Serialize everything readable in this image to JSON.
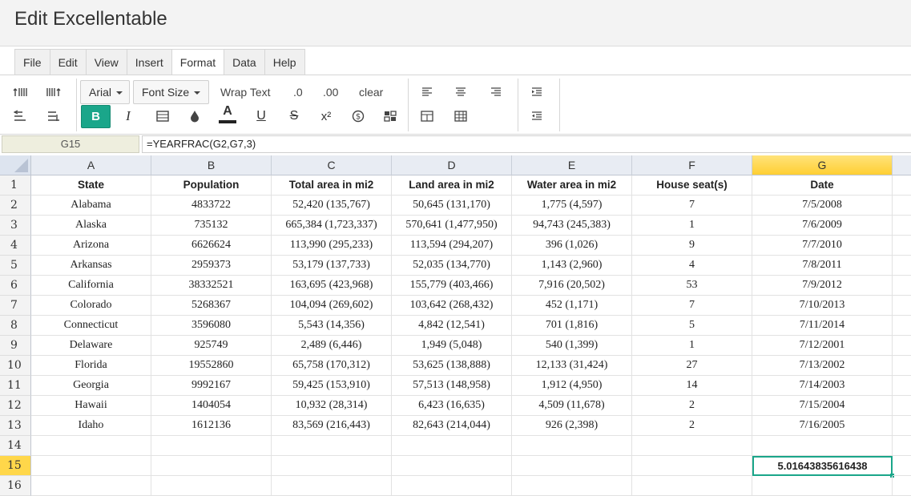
{
  "app": {
    "title": "Edit Excellentable"
  },
  "menu": {
    "items": [
      "File",
      "Edit",
      "View",
      "Insert",
      "Format",
      "Data",
      "Help"
    ],
    "active": "Format"
  },
  "toolbar": {
    "font_name": "Arial",
    "font_size": "Font Size",
    "wrap_text": "Wrap Text",
    "decimal_decrease": ".0",
    "decimal_increase": ".00",
    "clear": "clear",
    "bold": "B",
    "italic": "I",
    "text_color_letter": "A",
    "underline": "U",
    "strikethrough": "S",
    "superscript": "x²",
    "accent_color": "#1aa68a"
  },
  "formula_bar": {
    "cell_ref": "G15",
    "formula": "=YEARFRAC(G2,G7,3)"
  },
  "sheet": {
    "columns": [
      "A",
      "B",
      "C",
      "D",
      "E",
      "F",
      "G"
    ],
    "selected_column": "G",
    "selected_row": "15",
    "row_numbers": [
      "1",
      "2",
      "3",
      "4",
      "5",
      "6",
      "7",
      "8",
      "9",
      "10",
      "11",
      "12",
      "13",
      "14",
      "15",
      "16"
    ],
    "rows": [
      [
        "State",
        "Population",
        "Total area in mi2",
        "Land area in mi2",
        "Water area in mi2",
        "House seat(s)",
        "Date"
      ],
      [
        "Alabama",
        "4833722",
        "52,420 (135,767)",
        "50,645 (131,170)",
        "1,775 (4,597)",
        "7",
        "7/5/2008"
      ],
      [
        "Alaska",
        "735132",
        "665,384 (1,723,337)",
        "570,641 (1,477,950)",
        "94,743 (245,383)",
        "1",
        "7/6/2009"
      ],
      [
        "Arizona",
        "6626624",
        "113,990 (295,233)",
        "113,594 (294,207)",
        "396 (1,026)",
        "9",
        "7/7/2010"
      ],
      [
        "Arkansas",
        "2959373",
        "53,179 (137,733)",
        "52,035 (134,770)",
        "1,143 (2,960)",
        "4",
        "7/8/2011"
      ],
      [
        "California",
        "38332521",
        "163,695 (423,968)",
        "155,779 (403,466)",
        "7,916 (20,502)",
        "53",
        "7/9/2012"
      ],
      [
        "Colorado",
        "5268367",
        "104,094 (269,602)",
        "103,642 (268,432)",
        "452 (1,171)",
        "7",
        "7/10/2013"
      ],
      [
        "Connecticut",
        "3596080",
        "5,543 (14,356)",
        "4,842 (12,541)",
        "701 (1,816)",
        "5",
        "7/11/2014"
      ],
      [
        "Delaware",
        "925749",
        "2,489 (6,446)",
        "1,949 (5,048)",
        "540 (1,399)",
        "1",
        "7/12/2001"
      ],
      [
        "Florida",
        "19552860",
        "65,758 (170,312)",
        "53,625 (138,888)",
        "12,133 (31,424)",
        "27",
        "7/13/2002"
      ],
      [
        "Georgia",
        "9992167",
        "59,425 (153,910)",
        "57,513 (148,958)",
        "1,912 (4,950)",
        "14",
        "7/14/2003"
      ],
      [
        "Hawaii",
        "1404054",
        "10,932 (28,314)",
        "6,423 (16,635)",
        "4,509 (11,678)",
        "2",
        "7/15/2004"
      ],
      [
        "Idaho",
        "1612136",
        "83,569 (216,443)",
        "82,643 (214,044)",
        "926 (2,398)",
        "2",
        "7/16/2005"
      ],
      [
        "",
        "",
        "",
        "",
        "",
        "",
        ""
      ],
      [
        "",
        "",
        "",
        "",
        "",
        "",
        "5.01643835616438"
      ],
      [
        "",
        "",
        "",
        "",
        "",
        "",
        ""
      ]
    ]
  }
}
